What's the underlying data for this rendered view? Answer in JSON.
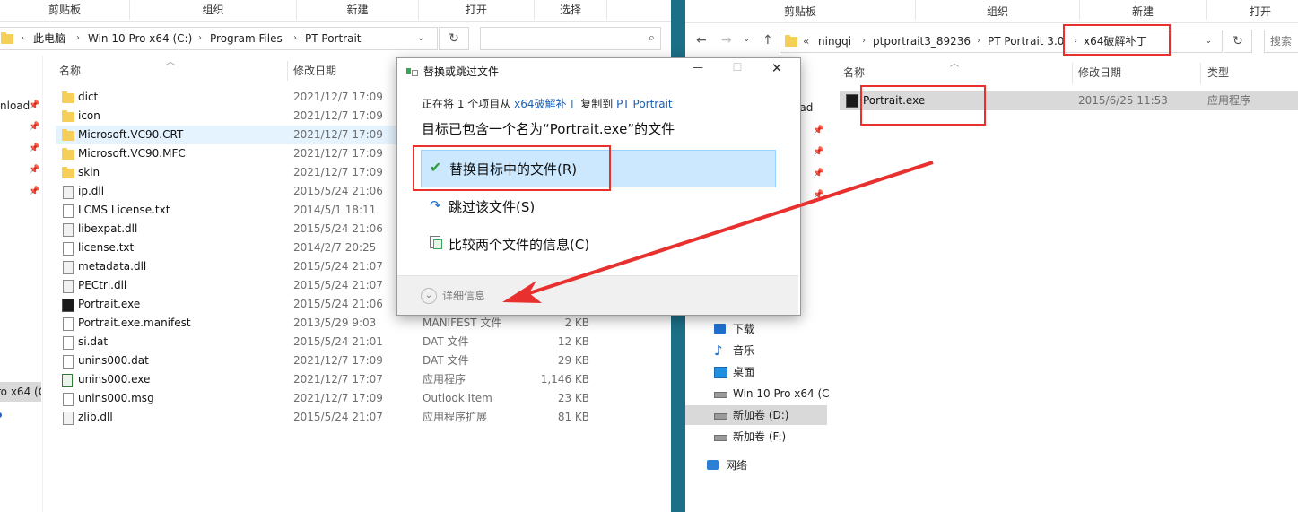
{
  "left": {
    "ribbon_tabs": [
      "剪贴板",
      "组织",
      "新建",
      "打开",
      "选择"
    ],
    "breadcrumb": [
      "此电脑",
      "Win 10 Pro x64 (C:)",
      "Program Files",
      "PT Portrait"
    ],
    "columns": {
      "name": "名称",
      "date": "修改日期"
    },
    "sidebar": [
      "nload",
      "ro x64 (C"
    ],
    "files": [
      {
        "name": "dict",
        "date": "2021/12/7 17:09",
        "type": "",
        "size": "",
        "icon": "folder-icon"
      },
      {
        "name": "icon",
        "date": "2021/12/7 17:09",
        "type": "",
        "size": "",
        "icon": "folder-icon"
      },
      {
        "name": "Microsoft.VC90.CRT",
        "date": "2021/12/7 17:09",
        "type": "",
        "size": "",
        "icon": "folder-icon"
      },
      {
        "name": "Microsoft.VC90.MFC",
        "date": "2021/12/7 17:09",
        "type": "",
        "size": "",
        "icon": "folder-icon"
      },
      {
        "name": "skin",
        "date": "2021/12/7 17:09",
        "type": "",
        "size": "",
        "icon": "folder-icon"
      },
      {
        "name": "ip.dll",
        "date": "2015/5/24 21:06",
        "type": "",
        "size": "",
        "icon": "dll-icon"
      },
      {
        "name": "LCMS License.txt",
        "date": "2014/5/1 18:11",
        "type": "",
        "size": "",
        "icon": "text-file-icon"
      },
      {
        "name": "libexpat.dll",
        "date": "2015/5/24 21:06",
        "type": "",
        "size": "",
        "icon": "dll-icon"
      },
      {
        "name": "license.txt",
        "date": "2014/2/7 20:25",
        "type": "",
        "size": "",
        "icon": "text-file-icon"
      },
      {
        "name": "metadata.dll",
        "date": "2015/5/24 21:07",
        "type": "",
        "size": "",
        "icon": "dll-icon"
      },
      {
        "name": "PECtrl.dll",
        "date": "2015/5/24 21:07",
        "type": "",
        "size": "",
        "icon": "dll-icon"
      },
      {
        "name": "Portrait.exe",
        "date": "2015/5/24 21:06",
        "type": "",
        "size": "",
        "icon": "exe-icon"
      },
      {
        "name": "Portrait.exe.manifest",
        "date": "2013/5/29 9:03",
        "type": "MANIFEST 文件",
        "size": "2 KB",
        "icon": "file-icon"
      },
      {
        "name": "si.dat",
        "date": "2015/5/24 21:01",
        "type": "DAT 文件",
        "size": "12 KB",
        "icon": "file-icon"
      },
      {
        "name": "unins000.dat",
        "date": "2021/12/7 17:09",
        "type": "DAT 文件",
        "size": "29 KB",
        "icon": "file-icon"
      },
      {
        "name": "unins000.exe",
        "date": "2021/12/7 17:07",
        "type": "应用程序",
        "size": "1,146 KB",
        "icon": "installer-icon"
      },
      {
        "name": "unins000.msg",
        "date": "2021/12/7 17:09",
        "type": "Outlook Item",
        "size": "23 KB",
        "icon": "file-icon"
      },
      {
        "name": "zlib.dll",
        "date": "2015/5/24 21:07",
        "type": "应用程序扩展",
        "size": "81 KB",
        "icon": "dll-icon"
      }
    ]
  },
  "right": {
    "ribbon_tabs": [
      "剪贴板",
      "组织",
      "新建",
      "打开"
    ],
    "breadcrumb": [
      "ningqi",
      "ptportrait3_89236",
      "PT Portrait 3.0",
      "x64破解补丁"
    ],
    "search_placeholder": "搜索",
    "columns": {
      "name": "名称",
      "date": "修改日期",
      "type": "类型"
    },
    "files": [
      {
        "name": "Portrait.exe",
        "date": "2015/6/25 11:53",
        "type": "应用程序"
      }
    ],
    "nav_partial": "oad",
    "nav": [
      {
        "label": "下载",
        "icon": "download-icon"
      },
      {
        "label": "音乐",
        "icon": "music-icon"
      },
      {
        "label": "桌面",
        "icon": "desktop-icon"
      },
      {
        "label": "Win 10 Pro x64 (C",
        "icon": "drive-icon"
      },
      {
        "label": "新加卷 (D:)",
        "icon": "drive-icon"
      },
      {
        "label": "新加卷 (F:)",
        "icon": "drive-icon"
      },
      {
        "label": "网络",
        "icon": "network-icon"
      }
    ]
  },
  "dialog": {
    "title": "替换或跳过文件",
    "line1_prefix": "正在将 1 个项目从",
    "line1_src": "x64破解补丁",
    "line1_mid": "复制到",
    "line1_dst": "PT Portrait",
    "heading": "目标已包含一个名为“Portrait.exe”的文件",
    "options": [
      "替换目标中的文件(R)",
      "跳过该文件(S)",
      "比较两个文件的信息(C)"
    ],
    "details": "详细信息",
    "accent": "#cce8ff"
  }
}
